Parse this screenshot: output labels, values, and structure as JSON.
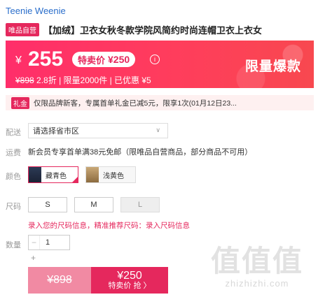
{
  "brand": "Teenie Weenie",
  "title": {
    "badge": "唯品自营",
    "text": "【加绒】卫衣女秋冬款学院风简约时尚连帽卫衣上衣女"
  },
  "price": {
    "currency": "¥",
    "value": "255",
    "special_label": "特卖价",
    "special_value": "¥250",
    "info_icon": "info-icon",
    "original": "¥898",
    "discount": "2.8折",
    "limit": "限量2000件",
    "saved": "已优惠 ¥5",
    "flash_label": "限量爆款"
  },
  "promo": {
    "tag": "礼金",
    "text": "仅限品牌新客，专属首单礼金已减5元，限享1次(01月12日23..."
  },
  "delivery": {
    "label": "配送",
    "placeholder": "请选择省市区"
  },
  "shipping": {
    "label": "运费",
    "text": "新会员专享首单满38元免邮（限唯品自营商品，部分商品不可用）"
  },
  "color": {
    "label": "颜色",
    "options": [
      {
        "name": "藏青色",
        "selected": true
      },
      {
        "name": "浅黄色",
        "selected": false
      }
    ]
  },
  "size": {
    "label": "尺码",
    "options": [
      "S",
      "M",
      "L"
    ],
    "help_prefix": "录入您的尺码信息，精准推荐尺码：",
    "help_link": "录入尺码信息"
  },
  "quantity": {
    "label": "数量",
    "value": "1",
    "minus": "−",
    "plus": "+"
  },
  "buttons": {
    "normal_price": "¥898",
    "special_price": "¥250",
    "special_label": "特卖价 抢 〉"
  },
  "watermark": {
    "big": "值值值",
    "small": "zhizhizhi.com"
  },
  "colors": {
    "accent": "#e5285d",
    "banner": "#ff3d5c",
    "brand_link": "#2a6ecb"
  }
}
